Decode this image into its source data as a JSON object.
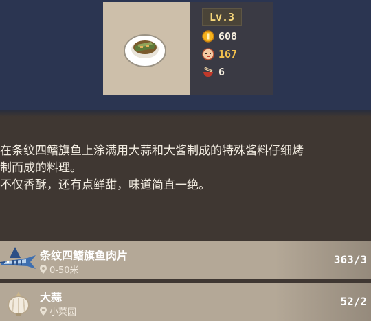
{
  "dish": {
    "level": "Lv.3",
    "stats": [
      {
        "icon": "coin-icon",
        "value": "608",
        "color": "#f3ecdd"
      },
      {
        "icon": "customer-face-icon",
        "value": "167",
        "color": "#f2c14e"
      },
      {
        "icon": "bowl-chopsticks-icon",
        "value": "6",
        "color": "#f3ecdd"
      }
    ]
  },
  "description": {
    "lines": [
      "在条纹四鳍旗鱼上涂满用大蒜和大酱制成的特殊酱料仔细烤",
      "制而成的料理。",
      "不仅香酥，还有点鲜甜，味道简直一绝。"
    ]
  },
  "ingredients": [
    {
      "name": "条纹四鳍旗鱼肉片",
      "location": "0-50米",
      "count": "363/3",
      "icon": "marlin-icon"
    },
    {
      "name": "大蒜",
      "location": "小菜园",
      "count": "52/2",
      "icon": "garlic-icon"
    }
  ],
  "colors": {
    "header_bg": "#2b3551",
    "panel_bg": "#3f3732",
    "row_bg": "#b4a897",
    "level_text": "#f5d67a",
    "highlight": "#f2c14e"
  }
}
